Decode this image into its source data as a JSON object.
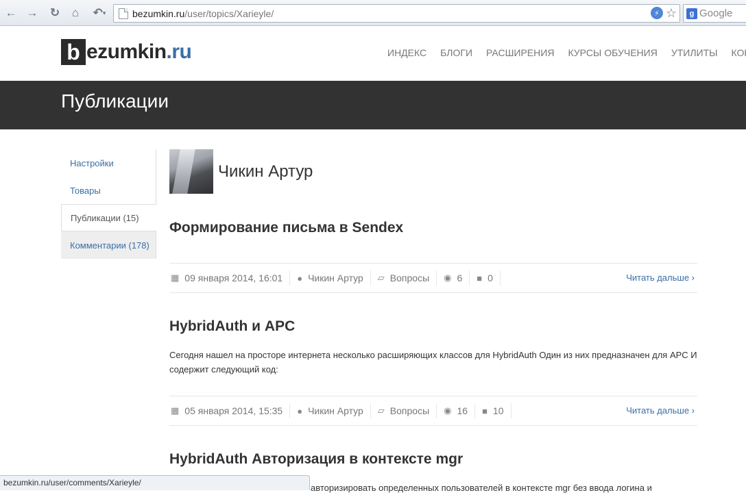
{
  "browser": {
    "url_host": "bezumkin.ru",
    "url_path": "/user/topics/Xarieyle/",
    "search_placeholder": "Google",
    "status_url": "bezumkin.ru/user/comments/Xarieyle/"
  },
  "site": {
    "logo_letter": "b",
    "logo_rest": "ezumkin",
    "logo_tld": ".ru",
    "nav": [
      "ИНДЕКС",
      "БЛОГИ",
      "РАСШИРЕНИЯ",
      "КУРСЫ ОБУЧЕНИЯ",
      "УТИЛИТЫ",
      "КОНТАКТЫ"
    ],
    "page_title": "Публикации"
  },
  "side_menu": [
    "Настройки",
    "Товары",
    "Публикации (15)",
    "Комментарии (178)"
  ],
  "profile": {
    "name": "Чикин Артур"
  },
  "posts": [
    {
      "title": "Формирование письма в Sendex",
      "excerpt": "",
      "date": "09 января 2014, 16:01",
      "author": "Чикин Артур",
      "section": "Вопросы",
      "views": "6",
      "comments": "0",
      "read_more": "Читать дальше ›"
    },
    {
      "title": "HybridAuth и APC",
      "excerpt": "Сегодня нашел на просторе интернета несколько расширяющих классов для HybridAuth Один из них предназначен для APC И содержит следующий код:",
      "date": "05 января 2014, 15:35",
      "author": "Чикин Артур",
      "section": "Вопросы",
      "views": "16",
      "comments": "10",
      "read_more": "Читать дальше ›"
    },
    {
      "title": "HybridAuth Авторизация в контексте mgr",
      "excerpt": "авторизировать определенных пользователей в контексте mgr без ввода логина и"
    }
  ]
}
